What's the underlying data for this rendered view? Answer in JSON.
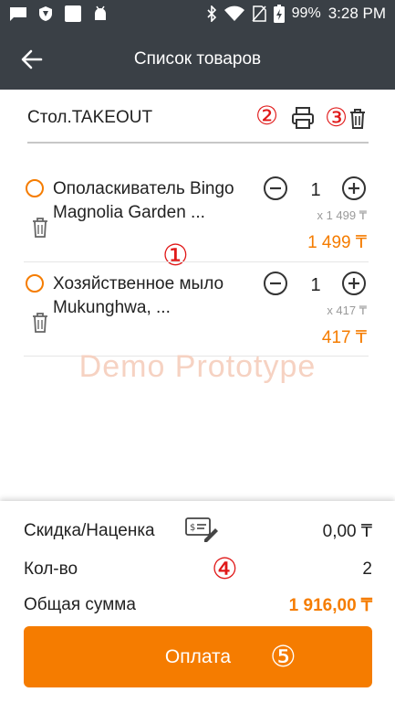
{
  "status_bar": {
    "battery": "99%",
    "time": "3:28 PM",
    "icons": [
      "message-icon",
      "shield-icon",
      "square-icon",
      "android-icon",
      "bluetooth-icon",
      "wifi-icon",
      "no-sim-icon",
      "battery-icon"
    ]
  },
  "header": {
    "title": "Список товаров",
    "back_icon": "arrow-left-icon"
  },
  "table": {
    "name": "Стол.TAKEOUT",
    "print_icon": "printer-icon",
    "delete_icon": "trash-icon"
  },
  "items": [
    {
      "name": "Ополаскиватель Bingo Magnolia Garden ...",
      "qty": "1",
      "unit_price": "x 1 499 ₸",
      "total": "1 499 ₸"
    },
    {
      "name": "Хозяйственное мыло Mukunghwa, ...",
      "qty": "1",
      "unit_price": "x 417 ₸",
      "total": "417 ₸"
    }
  ],
  "watermark": "Demo Prototype",
  "annotations": [
    "①",
    "②",
    "③",
    "④",
    "⑤"
  ],
  "summary": {
    "discount_label": "Скидка/Наценка",
    "discount_value": "0,00 ₸",
    "discount_icon": "receipt-edit-icon",
    "count_label": "Кол-во",
    "count_value": "2",
    "sum_label": "Общая сумма",
    "sum_value": "1 916,00 ₸"
  },
  "pay_button": "Оплата",
  "colors": {
    "accent": "#f57c00",
    "header_bg": "#3a4046",
    "annotation": "#e01818"
  }
}
